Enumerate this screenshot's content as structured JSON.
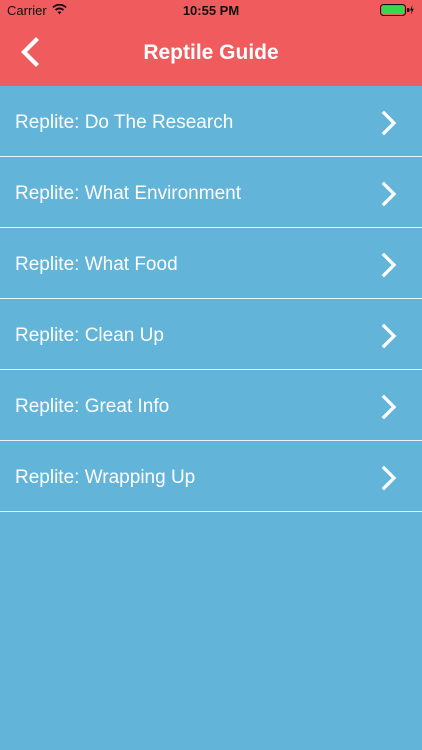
{
  "status_bar": {
    "carrier": "Carrier",
    "time": "10:55 PM"
  },
  "header": {
    "title": "Reptile Guide",
    "back_icon": "chevron-left-icon"
  },
  "list": {
    "items": [
      {
        "label": "Replite: Do The Research"
      },
      {
        "label": "Replite: What Environment"
      },
      {
        "label": "Replite: What Food"
      },
      {
        "label": "Replite: Clean Up"
      },
      {
        "label": "Replite: Great Info"
      },
      {
        "label": "Replite: Wrapping Up"
      }
    ],
    "row_icon": "chevron-right-icon"
  },
  "colors": {
    "header": "#f05b5d",
    "background": "#62b4d9",
    "text": "#ffffff",
    "divider": "#eaf5fb"
  }
}
